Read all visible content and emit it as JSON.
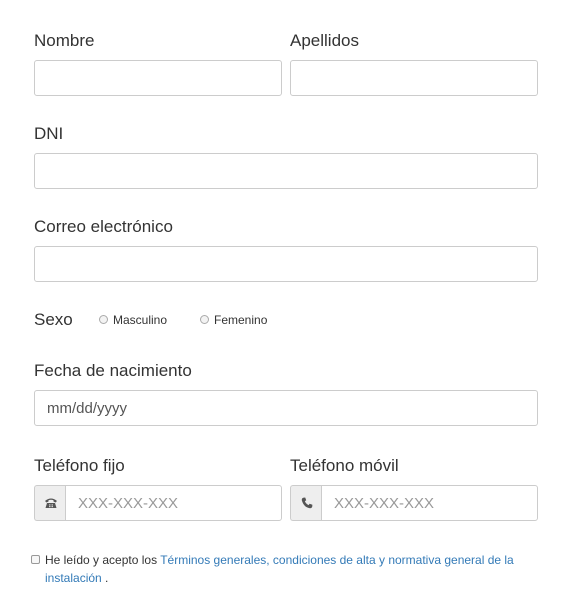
{
  "form": {
    "nombre": {
      "label": "Nombre",
      "value": "",
      "placeholder": ""
    },
    "apellidos": {
      "label": "Apellidos",
      "value": "",
      "placeholder": ""
    },
    "dni": {
      "label": "DNI",
      "value": "",
      "placeholder": ""
    },
    "correo": {
      "label": "Correo electrónico",
      "value": "",
      "placeholder": ""
    },
    "sexo": {
      "label": "Sexo",
      "options": [
        {
          "label": "Masculino",
          "selected": false
        },
        {
          "label": "Femenino",
          "selected": false
        }
      ]
    },
    "fecha_nacimiento": {
      "label": "Fecha de nacimiento",
      "placeholder": "mm/dd/yyyy",
      "value": ""
    },
    "telefono_fijo": {
      "label": "Teléfono fijo",
      "placeholder": "XXX-XXX-XXX",
      "icon": "landline-phone-icon",
      "value": ""
    },
    "telefono_movil": {
      "label": "Teléfono móvil",
      "placeholder": "XXX-XXX-XXX",
      "icon": "phone-handset-icon",
      "value": ""
    },
    "terms": {
      "checked": false,
      "prefix": "He leído y acepto los",
      "link_text": "Términos generales, condiciones de alta y normativa general de la instalación",
      "suffix": "."
    }
  },
  "colors": {
    "text": "#333333",
    "link": "#337ab7",
    "border": "#cccccc",
    "addon_bg": "#eeeeee"
  }
}
